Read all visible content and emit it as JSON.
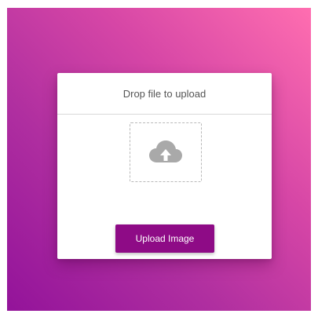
{
  "upload_card": {
    "title": "Drop file to upload",
    "drop_zone_icon": "cloud-upload-icon",
    "button_label": "Upload Image"
  },
  "colors": {
    "gradient_start": "#ff6eb0",
    "gradient_end": "#93139a",
    "button": "#8e0b86",
    "icon": "#a9a9a9"
  }
}
